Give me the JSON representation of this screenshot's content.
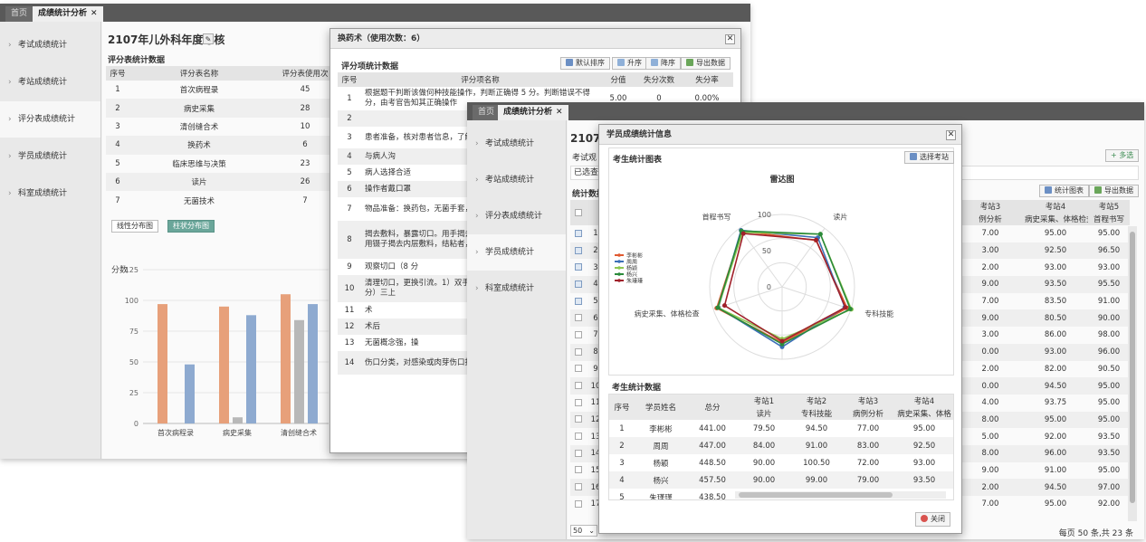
{
  "win1": {
    "tabs": [
      "首页",
      "成绩统计分析"
    ],
    "sidebar": [
      "考试成绩统计",
      "考站成绩统计",
      "评分表成绩统计",
      "学员成绩统计",
      "科室成绩统计"
    ],
    "exam_title": "2107年儿外科年度考核",
    "table_title": "评分表统计数据",
    "columns": [
      "序号",
      "评分表名称",
      "评分表使用次"
    ],
    "rows": [
      [
        "1",
        "首次病程录",
        "45"
      ],
      [
        "2",
        "病史采集",
        "28"
      ],
      [
        "3",
        "清创缝合术",
        "10"
      ],
      [
        "4",
        "换药术",
        "6"
      ],
      [
        "5",
        "临床思维与决策",
        "23"
      ],
      [
        "6",
        "读片",
        "26"
      ],
      [
        "7",
        "无菌技术",
        "7"
      ]
    ],
    "chart_buttons": [
      "线性分布图",
      "柱状分布图"
    ]
  },
  "chart_data": [
    {
      "type": "bar",
      "ylabel": "分数",
      "ylim": [
        0,
        125
      ],
      "yticks": [
        "0",
        "25",
        "50",
        "75",
        "100",
        "125"
      ],
      "categories": [
        "首次病程录",
        "病史采集",
        "清创缝合术"
      ],
      "series": [
        {
          "color": "#e7a07a",
          "values": [
            97,
            95,
            105
          ]
        },
        {
          "color": "#b8b8b8",
          "values": [
            0,
            5,
            84
          ]
        },
        {
          "color": "#8eaad0",
          "values": [
            48,
            88,
            97
          ]
        }
      ]
    },
    {
      "type": "radar",
      "title": "雷达图",
      "axes": [
        "读片",
        "专科技能",
        "病例分析",
        "病史采集、体格检查",
        "首程书写"
      ],
      "rticks": [
        "0",
        "50",
        "100"
      ],
      "rmax": 100,
      "series": [
        {
          "name": "李彬彬",
          "color": "#e05a30",
          "values": [
            79.5,
            94.5,
            77,
            95,
            95
          ]
        },
        {
          "name": "周周",
          "color": "#3b6fb6",
          "values": [
            84,
            91,
            83,
            92.5,
            96.5
          ]
        },
        {
          "name": "杨颖",
          "color": "#8ec651",
          "values": [
            90,
            100.5,
            72,
            93,
            93
          ]
        },
        {
          "name": "杨兴",
          "color": "#2a8a3a",
          "values": [
            90,
            99,
            79,
            93.5,
            95.5
          ]
        },
        {
          "name": "朱瑾瑾",
          "color": "#a0202a",
          "values": [
            80,
            92,
            75,
            83.5,
            91
          ]
        }
      ]
    }
  ],
  "dlg1": {
    "title": "换药术（使用次数：6）",
    "section_title": "评分项统计数据",
    "buttons": [
      "默认排序",
      "升序",
      "降序",
      "导出数据"
    ],
    "columns": [
      "序号",
      "评分项名称",
      "分值",
      "失分次数",
      "失分率"
    ],
    "rows": [
      {
        "no": "1",
        "name": "根据题干判断该做何种技能操作，判断正确得 5 分。判断错误不得分，由考官告知其正确操作",
        "score": "5.00",
        "lost": "0",
        "rate": "0.00%"
      },
      {
        "no": "2",
        "name": ""
      },
      {
        "no": "3",
        "name": "患者准备，核对患者信息，了解伤口深度，创口"
      },
      {
        "no": "4",
        "name": "与病人沟"
      },
      {
        "no": "5",
        "name": "病人选择合适"
      },
      {
        "no": "6",
        "name": "操作者戴口罩"
      },
      {
        "no": "7",
        "name": "物品准备：换药包，无菌手套，碘伏，品"
      },
      {
        "no": "8",
        "name": "揭去敷料，暴露切口。用手揭去外层敷料，放在弯盘中（5分），再用镊子揭去内层敷料，结粘者，可用盐水湿润后再揭"
      },
      {
        "no": "9",
        "name": "观察切口（8 分"
      },
      {
        "no": "10",
        "name": "清理切口，更换引流。1）双手持镊子清理切口及周围皮肤两次（10 分）三上"
      },
      {
        "no": "11",
        "name": "术"
      },
      {
        "no": "12",
        "name": "术后"
      },
      {
        "no": "13",
        "name": "无菌概念强，操"
      },
      {
        "no": "14",
        "name": "伤口分类，对感染或肉芽伤口换药宜，"
      }
    ]
  },
  "win2": {
    "tabs": [
      "首页",
      "成绩统计分析"
    ],
    "sidebar": [
      "考试成绩统计",
      "考站成绩统计",
      "评分表成绩统计",
      "学员成绩统计",
      "科室成绩统计"
    ],
    "exam_title": "2107年",
    "filter_label": "考试观",
    "selected_label": "已选查询",
    "section_label": "统计数据",
    "multi_select": "+ 多选",
    "buttons": [
      "统计图表",
      "导出数据"
    ],
    "table_header": [
      {
        "top": "考站3",
        "bottom": "例分析"
      },
      {
        "top": "考站4",
        "bottom": "病史采集、体格检查"
      },
      {
        "top": "考站5",
        "bottom": "首程书写"
      }
    ],
    "rows": [
      {
        "no": "1",
        "checked": true,
        "cells": [
          "7.00",
          "95.00",
          "95.00"
        ]
      },
      {
        "no": "2",
        "checked": true,
        "cells": [
          "3.00",
          "92.50",
          "96.50"
        ]
      },
      {
        "no": "3",
        "checked": true,
        "cells": [
          "2.00",
          "93.00",
          "93.00"
        ]
      },
      {
        "no": "4",
        "checked": true,
        "cells": [
          "9.00",
          "93.50",
          "95.50"
        ]
      },
      {
        "no": "5",
        "checked": true,
        "cells": [
          "7.00",
          "83.50",
          "91.00"
        ]
      },
      {
        "no": "6",
        "checked": false,
        "cells": [
          "9.00",
          "80.50",
          "90.00"
        ]
      },
      {
        "no": "7",
        "checked": false,
        "cells": [
          "3.00",
          "86.00",
          "98.00"
        ]
      },
      {
        "no": "8",
        "checked": false,
        "cells": [
          "0.00",
          "93.00",
          "96.00"
        ]
      },
      {
        "no": "9",
        "checked": false,
        "cells": [
          "2.00",
          "82.00",
          "90.50"
        ]
      },
      {
        "no": "10",
        "checked": false,
        "cells": [
          "0.00",
          "94.50",
          "95.00"
        ]
      },
      {
        "no": "11",
        "checked": false,
        "cells": [
          "4.00",
          "93.75",
          "95.00"
        ]
      },
      {
        "no": "12",
        "checked": false,
        "cells": [
          "8.00",
          "95.00",
          "95.00"
        ]
      },
      {
        "no": "13",
        "checked": false,
        "cells": [
          "5.00",
          "92.00",
          "93.50"
        ]
      },
      {
        "no": "14",
        "checked": false,
        "cells": [
          "8.00",
          "96.00",
          "93.50"
        ]
      },
      {
        "no": "15",
        "checked": false,
        "cells": [
          "9.00",
          "91.00",
          "95.00"
        ]
      },
      {
        "no": "16",
        "checked": false,
        "cells": [
          "2.00",
          "94.50",
          "97.00"
        ]
      },
      {
        "no": "17",
        "checked": false,
        "cells": [
          "7.00",
          "95.00",
          "92.00"
        ]
      }
    ],
    "page_size": "50",
    "pager_text": "每页 50 条,共 23 条"
  },
  "dlg2": {
    "title": "学员成绩统计信息",
    "chart_section": "考生统计图表",
    "select_station": "选择考站",
    "data_section": "考生统计数据",
    "table_columns": [
      {
        "top": "序号",
        "bottom": ""
      },
      {
        "top": "学员姓名",
        "bottom": ""
      },
      {
        "top": "总分",
        "bottom": ""
      },
      {
        "top": "考站1",
        "bottom": "读片"
      },
      {
        "top": "考站2",
        "bottom": "专科技能"
      },
      {
        "top": "考站3",
        "bottom": "病例分析"
      },
      {
        "top": "考站4",
        "bottom": "病史采集、体格"
      }
    ],
    "rows": [
      [
        "1",
        "李彬彬",
        "441.00",
        "79.50",
        "94.50",
        "77.00",
        "95.00"
      ],
      [
        "2",
        "周周",
        "447.00",
        "84.00",
        "91.00",
        "83.00",
        "92.50"
      ],
      [
        "3",
        "杨颖",
        "448.50",
        "90.00",
        "100.50",
        "72.00",
        "93.00"
      ],
      [
        "4",
        "杨兴",
        "457.50",
        "90.00",
        "99.00",
        "79.00",
        "93.50"
      ],
      [
        "5",
        "朱瑾瑾",
        "438.50",
        "",
        "",
        "",
        ""
      ]
    ],
    "close_label": "关闭"
  }
}
